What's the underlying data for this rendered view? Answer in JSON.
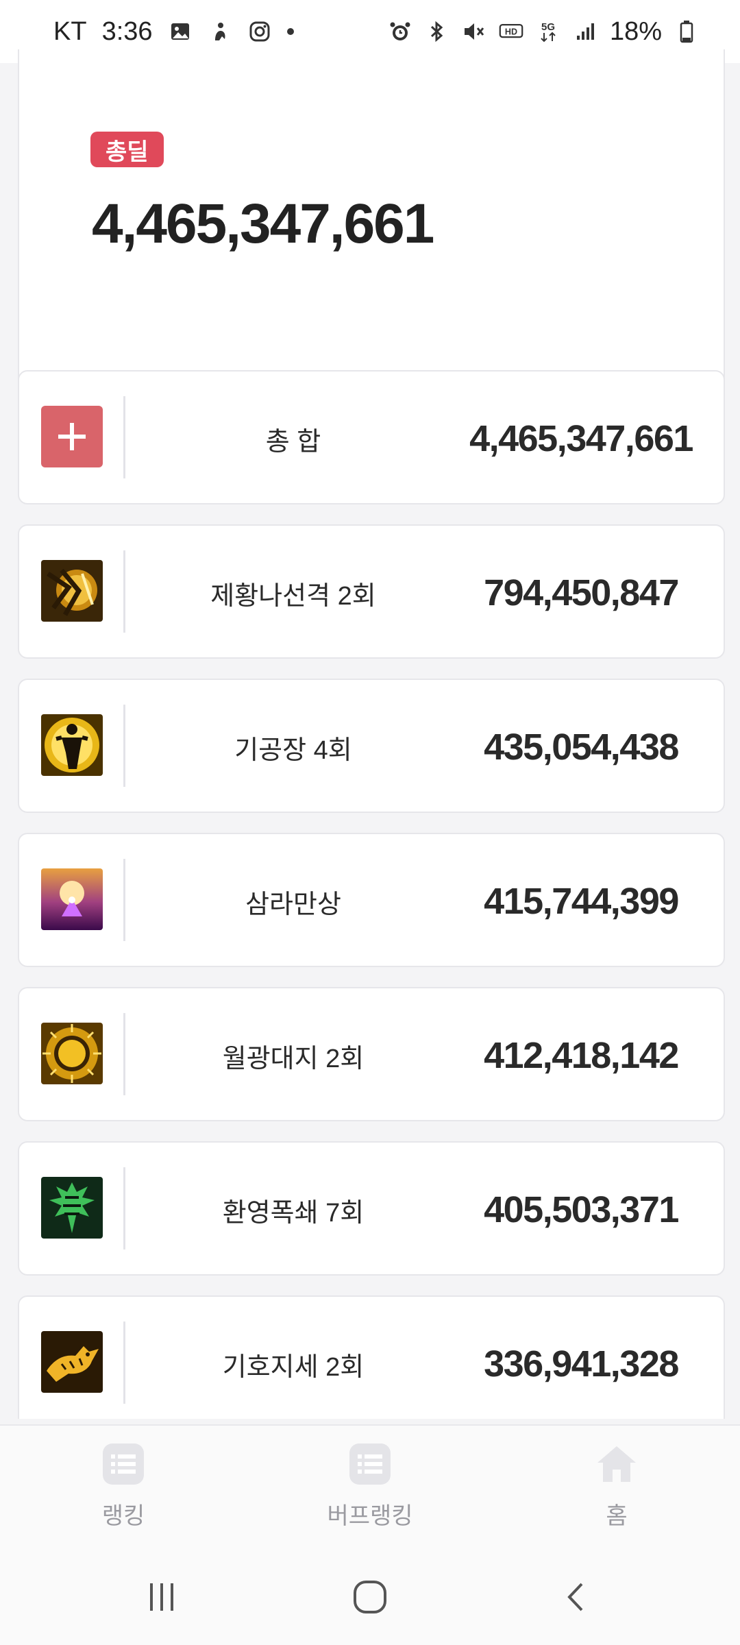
{
  "status_bar": {
    "carrier": "KT",
    "time": "3:36",
    "battery": "18%",
    "left_icons": [
      "gallery-icon",
      "accessibility-icon",
      "instagram-icon",
      "dot-icon"
    ],
    "right_icons": [
      "alarm-icon",
      "bluetooth-icon",
      "mute-icon",
      "hd-icon",
      "5g-icon",
      "signal-icon",
      "battery-icon"
    ]
  },
  "total": {
    "badge": "총딜",
    "value": "4,465,347,661",
    "badge_color": "#e0495a"
  },
  "rows": [
    {
      "name": "총 합",
      "value": "4,465,347,661",
      "icon": "plus-icon"
    },
    {
      "name": "제황나선격 2회",
      "value": "794,450,847",
      "icon": "skill-spiral-strike-icon"
    },
    {
      "name": "기공장 4회",
      "value": "435,054,438",
      "icon": "skill-qigong-palm-icon"
    },
    {
      "name": "삼라만상",
      "value": "415,744,399",
      "icon": "skill-samra-mansang-icon"
    },
    {
      "name": "월광대지 2회",
      "value": "412,418,142",
      "icon": "skill-moonlight-earth-icon"
    },
    {
      "name": "환영폭쇄 7회",
      "value": "405,503,371",
      "icon": "skill-phantom-blast-icon"
    },
    {
      "name": "기호지세 2회",
      "value": "336,941,328",
      "icon": "skill-tiger-stance-icon"
    }
  ],
  "bottom_nav": [
    {
      "label": "랭킹",
      "icon": "list-icon"
    },
    {
      "label": "버프랭킹",
      "icon": "list-icon"
    },
    {
      "label": "홈",
      "icon": "home-icon"
    }
  ],
  "colors": {
    "accent": "#e0495a",
    "plus_button": "#d9646a",
    "nav_text": "#9a9aa0"
  }
}
